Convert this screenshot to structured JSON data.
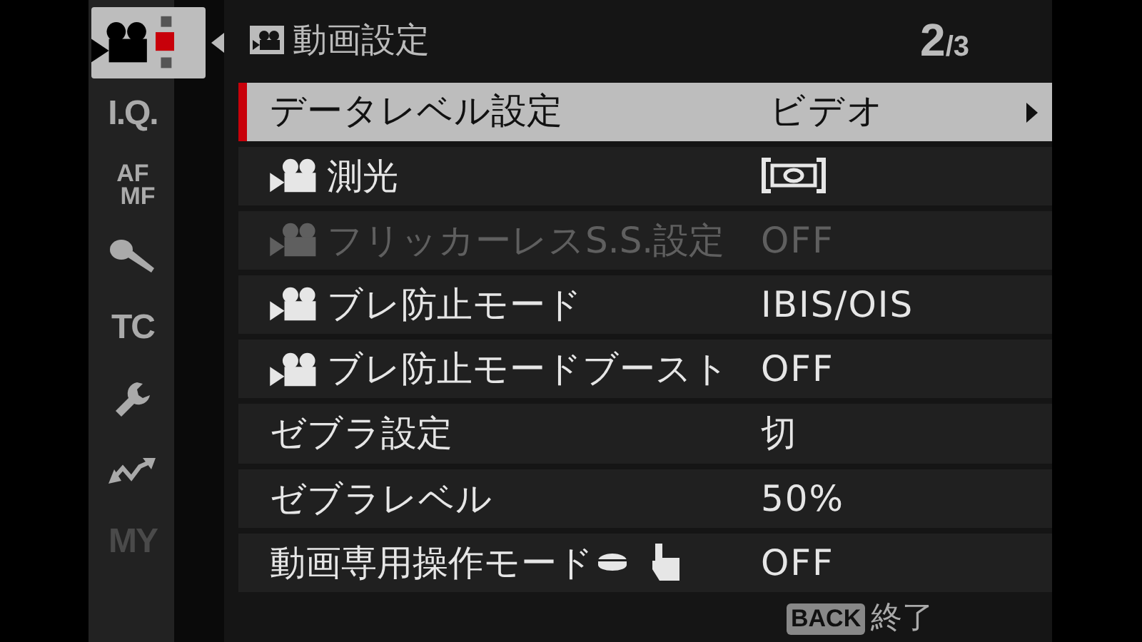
{
  "tabs": [
    {
      "kind": "movie",
      "selected": true,
      "disabled": false
    },
    {
      "kind": "text",
      "label": "I.Q.",
      "selected": false,
      "disabled": false
    },
    {
      "kind": "stack",
      "lines": [
        "AF",
        "MF"
      ],
      "selected": false,
      "disabled": false
    },
    {
      "kind": "mic",
      "selected": false,
      "disabled": false
    },
    {
      "kind": "text",
      "label": "TC",
      "selected": false,
      "disabled": false
    },
    {
      "kind": "wrench",
      "selected": false,
      "disabled": false
    },
    {
      "kind": "wave",
      "selected": false,
      "disabled": false
    },
    {
      "kind": "text",
      "label": "MY",
      "selected": false,
      "disabled": true
    }
  ],
  "header": {
    "title": "動画設定",
    "page_current": "2",
    "page_rest": "/3"
  },
  "rows": [
    {
      "label": "データレベル設定",
      "value": "ビデオ",
      "kind": "text",
      "movie_icon": false,
      "suffix_icons": false,
      "selected": true,
      "disabled": false,
      "arrow": true
    },
    {
      "label": "測光",
      "kind": "metering",
      "movie_icon": true,
      "suffix_icons": false,
      "selected": false,
      "disabled": false,
      "arrow": false
    },
    {
      "label": "フリッカーレスS.S.設定",
      "value": "OFF",
      "kind": "text",
      "movie_icon": true,
      "suffix_icons": false,
      "selected": false,
      "disabled": true,
      "arrow": false
    },
    {
      "label": "ブレ防止モード",
      "value": "IBIS/OIS",
      "kind": "text",
      "movie_icon": true,
      "suffix_icons": false,
      "selected": false,
      "disabled": false,
      "arrow": false
    },
    {
      "label": "ブレ防止モードブースト",
      "value": "OFF",
      "kind": "text",
      "movie_icon": true,
      "suffix_icons": false,
      "selected": false,
      "disabled": false,
      "arrow": false
    },
    {
      "label": "ゼブラ設定",
      "value": "切",
      "kind": "text",
      "movie_icon": false,
      "suffix_icons": false,
      "selected": false,
      "disabled": false,
      "arrow": false
    },
    {
      "label": "ゼブラレベル",
      "value": "50%",
      "kind": "text",
      "movie_icon": false,
      "suffix_icons": false,
      "selected": false,
      "disabled": false,
      "arrow": false
    },
    {
      "label": "動画専用操作モード",
      "value": "OFF",
      "kind": "text",
      "movie_icon": false,
      "suffix_icons": true,
      "selected": false,
      "disabled": false,
      "arrow": false
    }
  ],
  "footer": {
    "key": "BACK",
    "action": "終了"
  }
}
